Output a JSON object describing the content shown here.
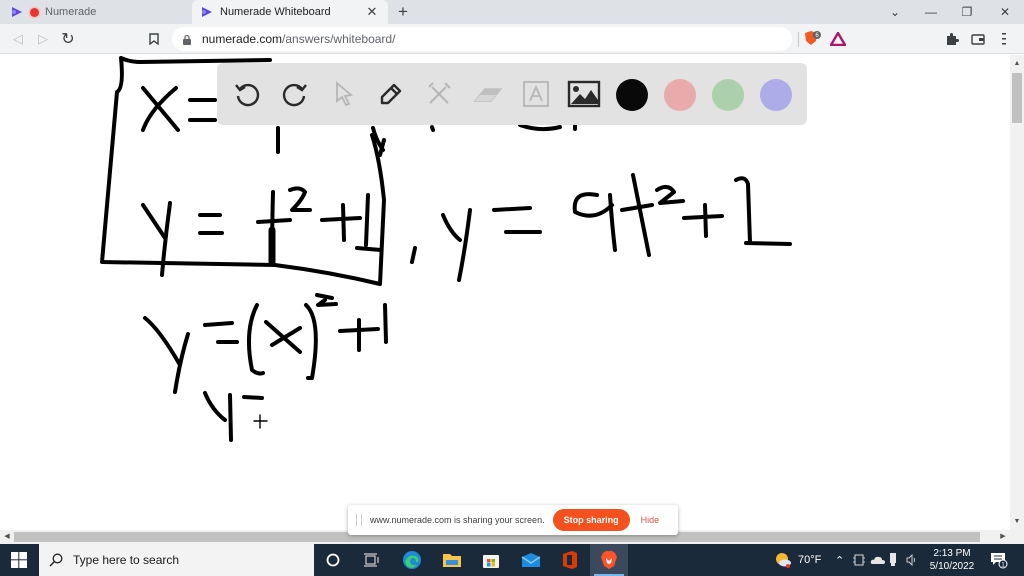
{
  "browser": {
    "tabs": [
      {
        "title": "Numerade",
        "active": false,
        "recording": true
      },
      {
        "title": "Numerade Whiteboard",
        "active": true
      }
    ],
    "new_tab_label": "+",
    "tab_close_glyph": "✕",
    "window_controls": {
      "tab_search": "⌄",
      "minimize": "—",
      "restore": "❐",
      "close": "✕"
    },
    "nav": {
      "back": "◁",
      "forward": "▷",
      "reload": "↻",
      "bookmark": "bookmark-icon"
    },
    "url": {
      "host": "numerade.com",
      "path": "/answers/whiteboard/"
    },
    "extensions": {
      "brave_shields_count": "6"
    }
  },
  "whiteboard": {
    "tools": [
      {
        "name": "undo",
        "enabled": true
      },
      {
        "name": "redo",
        "enabled": true
      },
      {
        "name": "select",
        "enabled": false
      },
      {
        "name": "pen",
        "enabled": true
      },
      {
        "name": "tools",
        "enabled": false
      },
      {
        "name": "eraser",
        "enabled": false
      },
      {
        "name": "text",
        "enabled": false
      },
      {
        "name": "image",
        "enabled": true
      }
    ],
    "colors": [
      {
        "name": "black",
        "hex": "#000000",
        "selected": true
      },
      {
        "name": "red",
        "hex": "#e8a7a7"
      },
      {
        "name": "green",
        "hex": "#a9cfa8"
      },
      {
        "name": "blue",
        "hex": "#aaa9e9"
      }
    ],
    "handwriting": [
      "x = t + 2 (partially hidden)",
      "y = t^2 + 1",
      ", y = 9t^2 + 1",
      "y = (x)^2 + 1",
      "y ="
    ]
  },
  "share_bar": {
    "message": "www.numerade.com is sharing your screen.",
    "stop_label": "Stop sharing",
    "hide_label": "Hide"
  },
  "taskbar": {
    "search_placeholder": "Type here to search",
    "apps": [
      "cortana",
      "task-view",
      "edge",
      "file-explorer",
      "microsoft-store",
      "mail",
      "office",
      "brave"
    ],
    "weather": "70°F",
    "time": "2:13 PM",
    "date": "5/10/2022",
    "notification_count": "1"
  },
  "colors": {
    "accent_stop": "#f4511e",
    "taskbar_bg": "#1b2a3a",
    "toolbar_bg": "#e1e1e1"
  }
}
